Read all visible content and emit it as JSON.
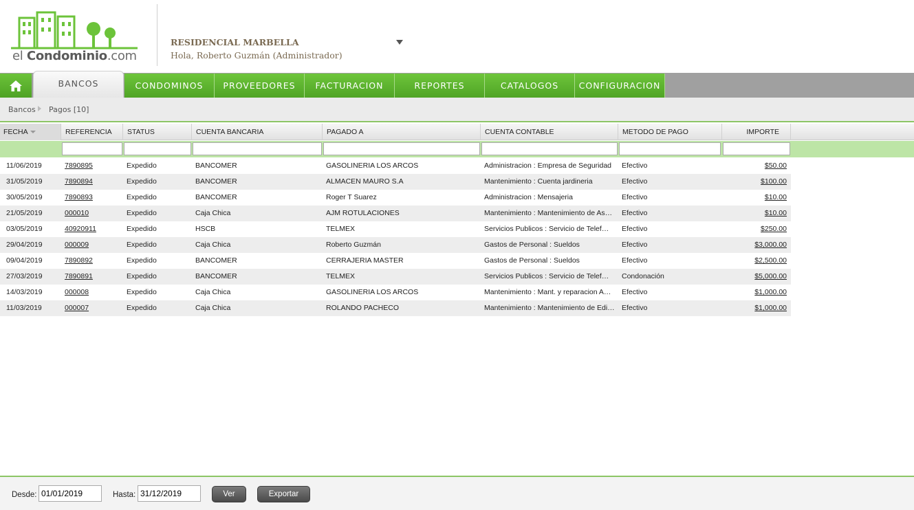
{
  "brand": {
    "logo_light": "el ",
    "logo_bold": "Condominio",
    "logo_tail": ".com",
    "accent": "#5cb531"
  },
  "header": {
    "condo_name": "RESIDENCIAL MARBELLA",
    "greeting": "Hola, Roberto Guzmán (Administrador)"
  },
  "nav": {
    "tabs": [
      "BANCOS",
      "CONDOMINOS",
      "PROVEEDORES",
      "FACTURACION",
      "REPORTES",
      "CATALOGOS",
      "CONFIGURACION"
    ]
  },
  "breadcrumb": {
    "root": "Bancos",
    "current": "Pagos [10]"
  },
  "table": {
    "columns": [
      "FECHA",
      "REFERENCIA",
      "STATUS",
      "CUENTA BANCARIA",
      "PAGADO A",
      "CUENTA CONTABLE",
      "METODO DE PAGO",
      "IMPORTE"
    ],
    "rows": [
      [
        "11/06/2019",
        "7890895",
        "Expedido",
        "BANCOMER",
        "GASOLINERIA LOS ARCOS",
        "Administracion : Empresa de Seguridad",
        "Efectivo",
        "$50.00"
      ],
      [
        "31/05/2019",
        "7890894",
        "Expedido",
        "BANCOMER",
        "ALMACEN MAURO S.A",
        "Mantenimiento : Cuenta jardineria",
        "Efectivo",
        "$100.00"
      ],
      [
        "30/05/2019",
        "7890893",
        "Expedido",
        "BANCOMER",
        "Roger T Suarez",
        "Administracion : Mensajeria",
        "Efectivo",
        "$10.00"
      ],
      [
        "21/05/2019",
        "000010",
        "Expedido",
        "Caja Chica",
        "AJM ROTULACIONES",
        "Mantenimiento : Mantenimiento de As…",
        "Efectivo",
        "$10.00"
      ],
      [
        "03/05/2019",
        "40920911",
        "Expedido",
        "HSCB",
        "TELMEX",
        "Servicios Publicos : Servicio de Telef…",
        "Efectivo",
        "$250.00"
      ],
      [
        "29/04/2019",
        "000009",
        "Expedido",
        "Caja Chica",
        "Roberto Guzmán",
        "Gastos de Personal : Sueldos",
        "Efectivo",
        "$3,000.00"
      ],
      [
        "09/04/2019",
        "7890892",
        "Expedido",
        "BANCOMER",
        "CERRAJERIA MASTER",
        "Gastos de Personal : Sueldos",
        "Efectivo",
        "$2,500.00"
      ],
      [
        "27/03/2019",
        "7890891",
        "Expedido",
        "BANCOMER",
        "TELMEX",
        "Servicios Publicos : Servicio de Telef…",
        "Condonación",
        "$5,000.00"
      ],
      [
        "14/03/2019",
        "000008",
        "Expedido",
        "Caja Chica",
        "GASOLINERIA LOS ARCOS",
        "Mantenimiento : Mant. y reparacion A…",
        "Efectivo",
        "$1,000.00"
      ],
      [
        "11/03/2019",
        "000007",
        "Expedido",
        "Caja Chica",
        "ROLANDO PACHECO",
        "Mantenimiento : Mantenimiento de Edi…",
        "Efectivo",
        "$1,000.00"
      ]
    ]
  },
  "footer": {
    "desde_label": "Desde:",
    "desde_value": "01/01/2019",
    "hasta_label": "Hasta:",
    "hasta_value": "31/12/2019",
    "ver_label": "Ver",
    "exportar_label": "Exportar"
  }
}
